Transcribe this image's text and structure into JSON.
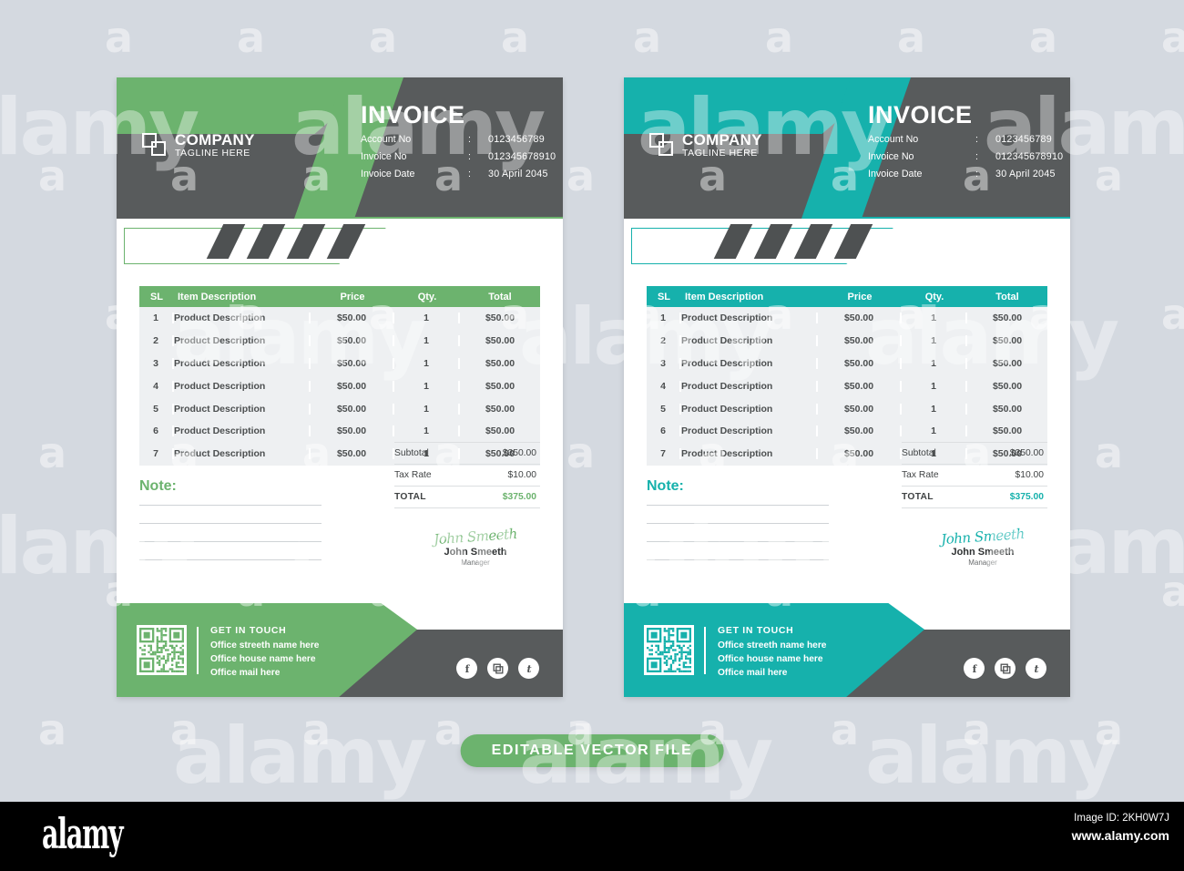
{
  "page": {
    "background_color": "#d4d9e0",
    "watermark_letter": "a",
    "watermark_word": "alamy"
  },
  "badge": {
    "label": "EDITABLE VECTOR  FILE",
    "color": "#6cb36e"
  },
  "bottom_bar": {
    "logo": "alamy",
    "image_id": "Image ID: 2KH0W7J",
    "url": "www.alamy.com"
  },
  "variants": [
    {
      "id": "green",
      "accent": "#6cb36e",
      "dark": "#585b5c"
    },
    {
      "id": "teal",
      "accent": "#16b1ac",
      "dark": "#585b5c"
    }
  ],
  "invoice": {
    "title": "INVOICE",
    "company": {
      "name": "COMPANY",
      "tagline": "TAGLINE HERE"
    },
    "meta": [
      {
        "key": "Account No",
        "colon": ":",
        "value": "0123456789"
      },
      {
        "key": "Invoice No",
        "colon": ":",
        "value": "012345678910"
      },
      {
        "key": "Invoice Date",
        "colon": ":",
        "value": "30 April 2045"
      }
    ],
    "table": {
      "headers": [
        "SL",
        "Item Description",
        "Price",
        "Qty.",
        "Total"
      ],
      "rows": [
        {
          "sl": "1",
          "desc": "Product Description",
          "price": "$50.00",
          "qty": "1",
          "total": "$50.00"
        },
        {
          "sl": "2",
          "desc": "Product Description",
          "price": "$50.00",
          "qty": "1",
          "total": "$50.00"
        },
        {
          "sl": "3",
          "desc": "Product Description",
          "price": "$50.00",
          "qty": "1",
          "total": "$50.00"
        },
        {
          "sl": "4",
          "desc": "Product Description",
          "price": "$50.00",
          "qty": "1",
          "total": "$50.00"
        },
        {
          "sl": "5",
          "desc": "Product Description",
          "price": "$50.00",
          "qty": "1",
          "total": "$50.00"
        },
        {
          "sl": "6",
          "desc": "Product Description",
          "price": "$50.00",
          "qty": "1",
          "total": "$50.00"
        },
        {
          "sl": "7",
          "desc": "Product Description",
          "price": "$50.00",
          "qty": "1",
          "total": "$50.00"
        }
      ]
    },
    "totals": [
      {
        "label": "Subtotal",
        "value": "$350.00"
      },
      {
        "label": "Tax Rate",
        "value": "$10.00"
      },
      {
        "label": "TOTAL",
        "value": "$375.00"
      }
    ],
    "note": {
      "title": "Note:",
      "line_count": 4
    },
    "signature": {
      "script": "John Smeeth",
      "name": "John Smeeth",
      "role": "Manager"
    },
    "footer": {
      "heading": "GET IN TOUCH",
      "lines": [
        "Office streeth name here",
        "Office house name here",
        "Office mail here"
      ],
      "socials": [
        "facebook-icon",
        "instagram-icon",
        "twitter-icon"
      ]
    }
  }
}
